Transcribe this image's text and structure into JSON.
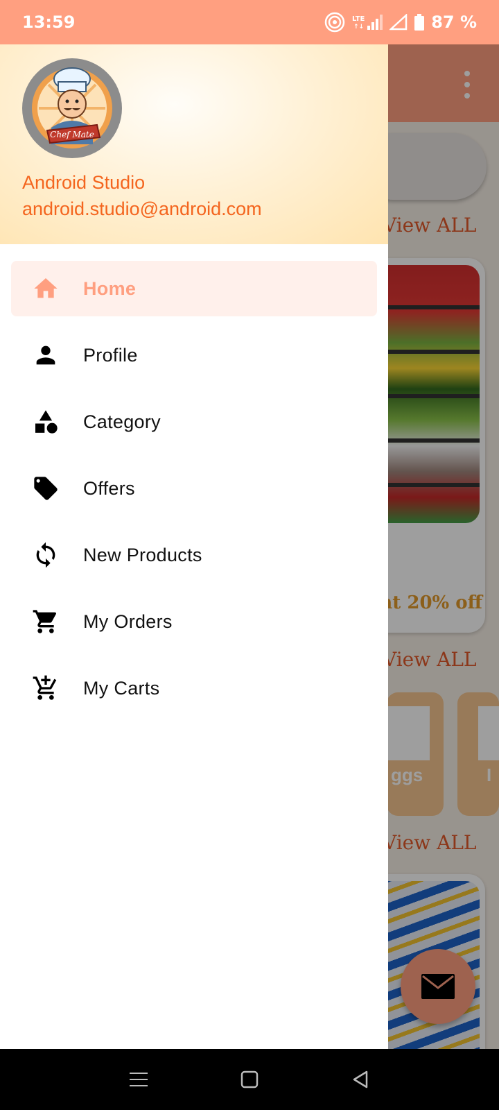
{
  "status_bar": {
    "time": "13:59",
    "battery": "87 %",
    "network": "LTE"
  },
  "background": {
    "view_all_labels": [
      "View ALL",
      "View ALL",
      "View ALL"
    ],
    "offer_text": "nt 20% off",
    "chip_labels": [
      "ggs",
      "I"
    ]
  },
  "drawer": {
    "user_name": "Android Studio",
    "user_email": "android.studio@android.com",
    "logo_text": "Chef Mate",
    "items": [
      {
        "label": "Home",
        "icon": "home-icon",
        "active": true
      },
      {
        "label": "Profile",
        "icon": "person-icon",
        "active": false
      },
      {
        "label": "Category",
        "icon": "category-icon",
        "active": false
      },
      {
        "label": "Offers",
        "icon": "tag-icon",
        "active": false
      },
      {
        "label": "New Products",
        "icon": "refresh-icon",
        "active": false
      },
      {
        "label": "My Orders",
        "icon": "cart-icon",
        "active": false
      },
      {
        "label": "My Carts",
        "icon": "add-cart-icon",
        "active": false
      }
    ]
  },
  "colors": {
    "accent": "#ff9f80",
    "user_text": "#f4651e",
    "active_bg": "#fff0eb"
  }
}
